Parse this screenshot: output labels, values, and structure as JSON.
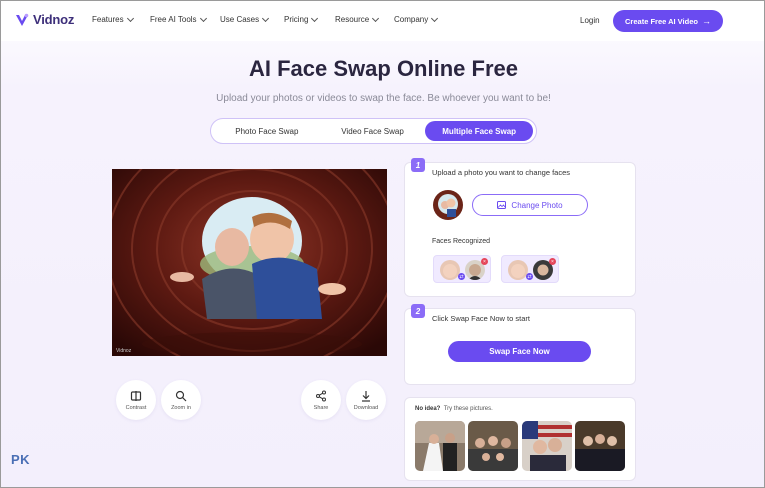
{
  "brand": {
    "name": "Vidnoz",
    "accent": "#6a4bf0"
  },
  "nav": {
    "items": [
      "Features",
      "Free AI Tools",
      "Use Cases",
      "Pricing",
      "Resource",
      "Company"
    ],
    "login": "Login",
    "cta": "Create Free AI Video"
  },
  "hero": {
    "title": "AI Face Swap Online Free",
    "subtitle": "Upload your photos or videos to swap the face. Be whoever you want to be!"
  },
  "tabs": [
    {
      "label": "Photo Face Swap",
      "active": false
    },
    {
      "label": "Video Face Swap",
      "active": false
    },
    {
      "label": "Multiple Face Swap",
      "active": true
    }
  ],
  "preview": {
    "watermark": "Vidnoz",
    "tools_left": [
      {
        "label": "Contrast",
        "icon": "contrast-icon"
      },
      {
        "label": "Zoom in",
        "icon": "zoom-in-icon"
      }
    ],
    "tools_right": [
      {
        "label": "Share",
        "icon": "share-icon"
      },
      {
        "label": "Download",
        "icon": "download-icon"
      }
    ]
  },
  "step1": {
    "number": "1",
    "text": "Upload a photo you want to change faces",
    "change_button": "Change Photo",
    "faces_label": "Faces Recognized"
  },
  "step2": {
    "number": "2",
    "text": "Click Swap Face Now to start",
    "button": "Swap Face Now"
  },
  "ideas": {
    "bold": "No idea?",
    "text": "Try these pictures."
  },
  "watermark": {
    "text": "PK"
  }
}
